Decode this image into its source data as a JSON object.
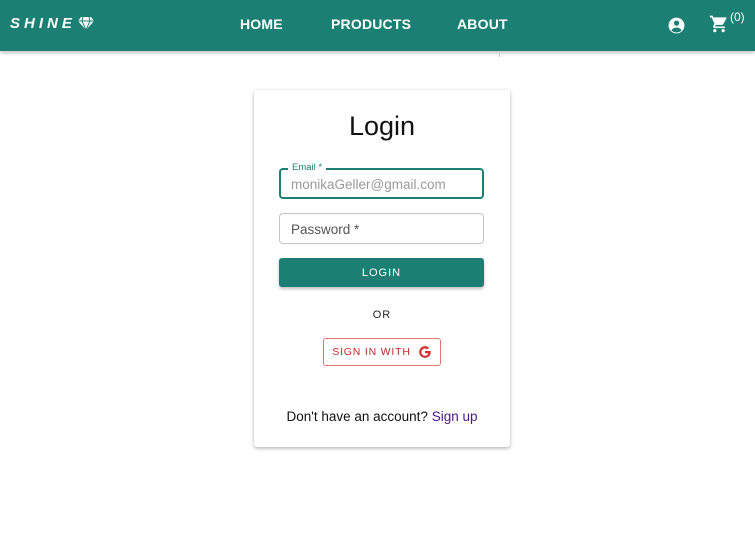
{
  "navbar": {
    "brand": "SHINE",
    "links": [
      {
        "label": "HOME"
      },
      {
        "label": "PRODUCTS"
      },
      {
        "label": "ABOUT"
      }
    ],
    "account_icon": "account-circle-icon",
    "cart_icon": "shopping-cart-icon",
    "cart_count": "(0)",
    "background": "#1c7f73"
  },
  "login": {
    "title": "Login",
    "email": {
      "label": "Email *",
      "value": "monikaGeller@gmail.com"
    },
    "password": {
      "placeholder": "Password *"
    },
    "login_button": "LOGIN",
    "or_text": "OR",
    "google_button": "SIGN IN WITH",
    "google_icon": "google-icon",
    "signup_prompt": "Don't have an account?",
    "signup_link": "Sign up"
  },
  "colors": {
    "accent": "#1c7f73",
    "google_red": "#c62828",
    "link": "#4a148c"
  }
}
